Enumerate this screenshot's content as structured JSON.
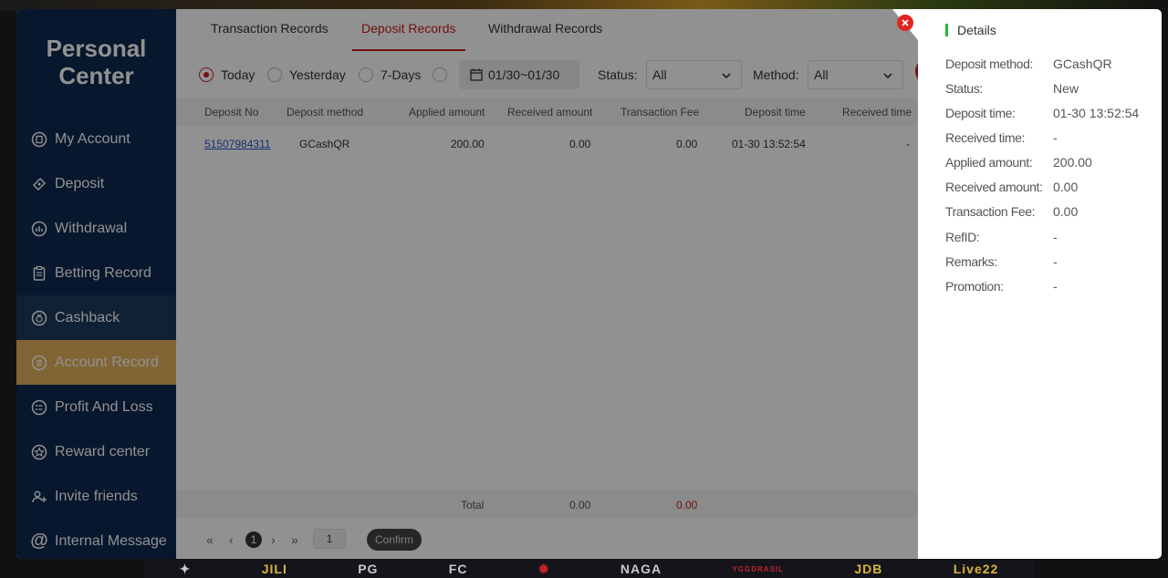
{
  "sidebar": {
    "title_line1": "Personal",
    "title_line2": "Center",
    "items": [
      {
        "label": "My Account",
        "icon": "account-icon"
      },
      {
        "label": "Deposit",
        "icon": "deposit-icon"
      },
      {
        "label": "Withdrawal",
        "icon": "withdrawal-icon"
      },
      {
        "label": "Betting Record",
        "icon": "clipboard-icon"
      },
      {
        "label": "Cashback",
        "icon": "cashback-icon"
      },
      {
        "label": "Account Record",
        "icon": "list-icon"
      },
      {
        "label": "Profit And Loss",
        "icon": "profit-icon"
      },
      {
        "label": "Reward center",
        "icon": "star-icon"
      },
      {
        "label": "Invite friends",
        "icon": "invite-icon"
      },
      {
        "label": "Internal Message",
        "icon": "at-icon"
      }
    ]
  },
  "tabs": [
    "Transaction Records",
    "Deposit Records",
    "Withdrawal Records"
  ],
  "filters": {
    "ranges": [
      "Today",
      "Yesterday",
      "7-Days"
    ],
    "date": "01/30~01/30",
    "status_label": "Status:",
    "status_value": "All",
    "method_label": "Method:",
    "method_value": "All"
  },
  "table": {
    "headers": [
      "Deposit No",
      "Deposit method",
      "Applied amount",
      "Received amount",
      "Transaction Fee",
      "Deposit time",
      "Received time"
    ],
    "row": {
      "deposit_no": "51507984311",
      "method": "GCashQR",
      "applied": "200.00",
      "received": "0.00",
      "fee": "0.00",
      "deposit_time": "01-30 13:52:54",
      "received_time": "-"
    },
    "total": {
      "label": "Total",
      "applied": "0.00",
      "received": "0.00"
    }
  },
  "pager": {
    "current": "1",
    "input": "1",
    "confirm": "Confirm"
  },
  "details": {
    "title": "Details",
    "rows": [
      {
        "k": "Deposit method:",
        "v": "GCashQR"
      },
      {
        "k": "Status:",
        "v": "New"
      },
      {
        "k": "Deposit time:",
        "v": "01-30 13:52:54"
      },
      {
        "k": "Received time:",
        "v": "-"
      },
      {
        "k": "Applied amount:",
        "v": "200.00"
      },
      {
        "k": "Received amount:",
        "v": "0.00"
      },
      {
        "k": "Transaction Fee:",
        "v": "0.00"
      },
      {
        "k": "RefID:",
        "v": "-"
      },
      {
        "k": "Remarks:",
        "v": "-"
      },
      {
        "k": "Promotion:",
        "v": "-"
      }
    ]
  },
  "bottom_logos": [
    "JILI",
    "PG",
    "FC",
    "NAGA",
    "JDB",
    "YGGDRASIL",
    "Live22"
  ],
  "colors": {
    "accent": "#c81d1d",
    "sidebar": "#0e2a4f",
    "active_item": "#e3b25c",
    "detail_marker": "#22bb33"
  }
}
